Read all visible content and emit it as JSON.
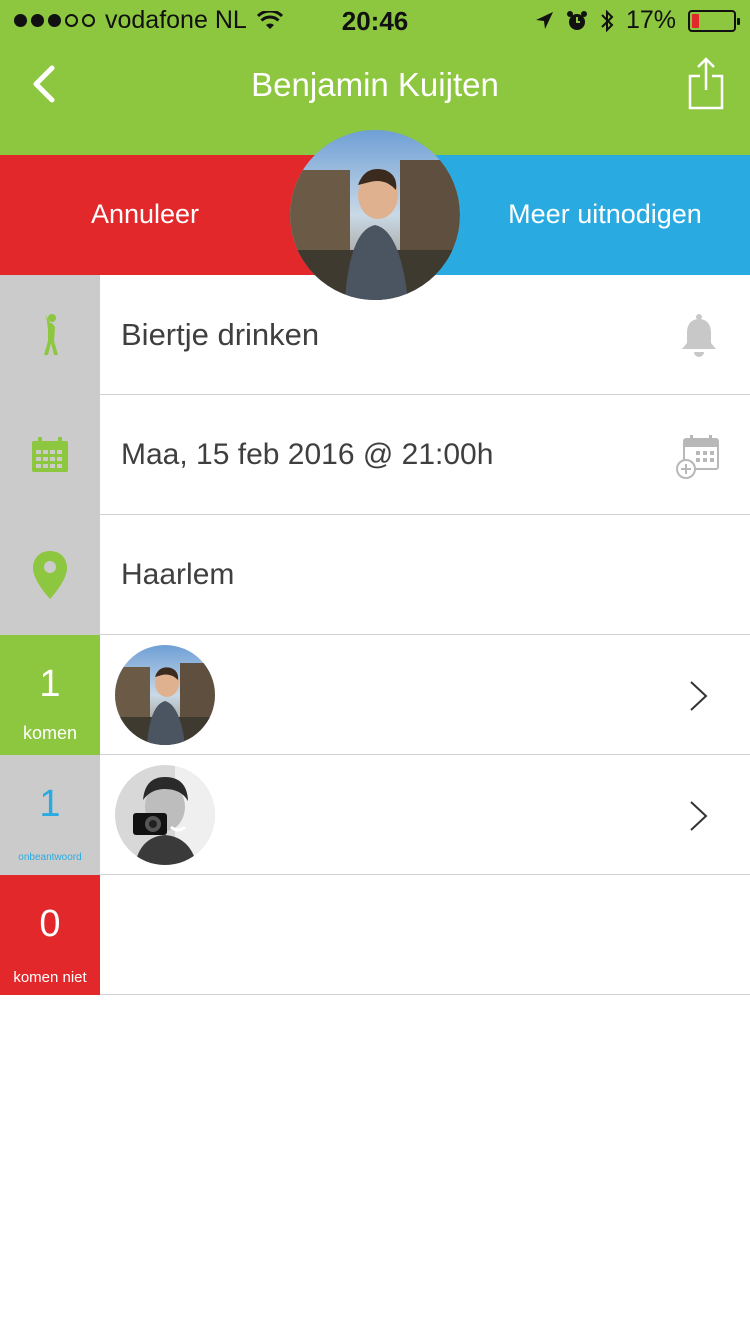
{
  "status_bar": {
    "carrier": "vodafone NL",
    "time": "20:46",
    "battery": "17%",
    "battery_level": 0.17
  },
  "nav": {
    "title": "Benjamin Kuijten",
    "back_icon": "chevron-left-icon",
    "share_icon": "share-icon"
  },
  "actions": {
    "cancel_label": "Annuleer",
    "invite_label": "Meer uitnodigen"
  },
  "event": {
    "activity": "Biertje drinken",
    "datetime": "Maa, 15 feb 2016 @ 21:00h",
    "location": "Haarlem"
  },
  "rsvp": {
    "coming": {
      "count": "1",
      "label": "komen"
    },
    "unanswered": {
      "count": "1",
      "label": "onbeantwoord"
    },
    "not_coming": {
      "count": "0",
      "label": "komen niet"
    }
  },
  "colors": {
    "green": "#8dc63f",
    "red": "#e2282a",
    "blue": "#29abe2",
    "grey": "#cbcbcb"
  }
}
